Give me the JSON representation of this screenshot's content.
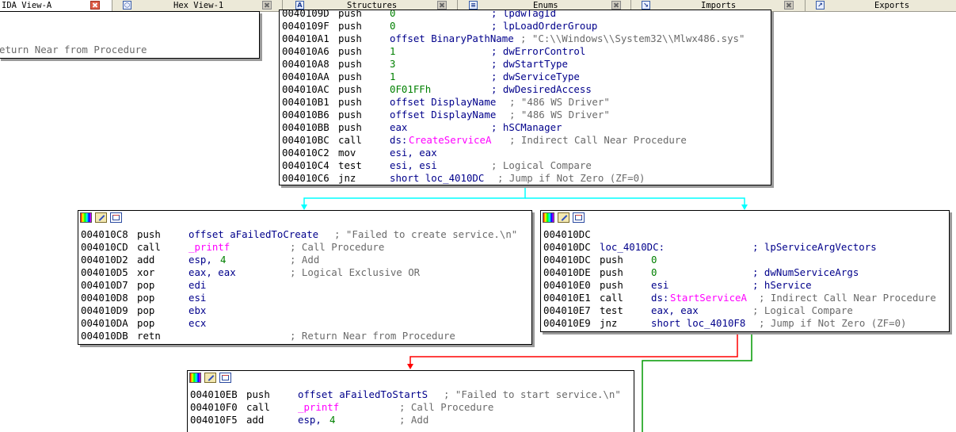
{
  "tabs": [
    {
      "label": "IDA View-A",
      "icon": "ida-view-icon",
      "active": true
    },
    {
      "label": "Hex View-1",
      "icon": "hex-view-icon",
      "active": false
    },
    {
      "label": "Structures",
      "icon": "structures-icon",
      "active": false
    },
    {
      "label": "Enums",
      "icon": "enums-icon",
      "active": false
    },
    {
      "label": "Imports",
      "icon": "imports-icon",
      "active": false
    },
    {
      "label": "Exports",
      "icon": "exports-icon",
      "active": false
    }
  ],
  "colors": {
    "edge_unconditional": "#00ffff",
    "edge_false": "#ff0000",
    "edge_true": "#009900",
    "edge_down": "#0000ff",
    "operand": "#00008b",
    "number": "#008000",
    "api": "#ff00ff",
    "comment": "#6a6a6a"
  },
  "block_top_left": {
    "line": {
      "comment": "eturn Near from Procedure"
    }
  },
  "block_main": {
    "partial_top": {
      "addr": "0040109D",
      "mnem": "push",
      "op": "0",
      "comment": "; lpdwTagId"
    },
    "lines": [
      {
        "addr": "0040109F",
        "mnem": "push",
        "op": "0",
        "comment": "; lpLoadOrderGroup"
      },
      {
        "addr": "004010A1",
        "mnem": "push",
        "op": "offset BinaryPathName",
        "comment": "; \"C:\\\\Windows\\\\System32\\\\Mlwx486.sys\""
      },
      {
        "addr": "004010A6",
        "mnem": "push",
        "op": "1",
        "comment": "; dwErrorControl"
      },
      {
        "addr": "004010A8",
        "mnem": "push",
        "op": "3",
        "comment": "; dwStartType"
      },
      {
        "addr": "004010AA",
        "mnem": "push",
        "op": "1",
        "comment": "; dwServiceType"
      },
      {
        "addr": "004010AC",
        "mnem": "push",
        "op": "0F01FFh",
        "comment": "; dwDesiredAccess"
      },
      {
        "addr": "004010B1",
        "mnem": "push",
        "op": "offset DisplayName",
        "comment": "; \"486 WS Driver\""
      },
      {
        "addr": "004010B6",
        "mnem": "push",
        "op": "offset DisplayName",
        "comment": "; \"486 WS Driver\""
      },
      {
        "addr": "004010BB",
        "mnem": "push",
        "op": "eax",
        "comment": "; hSCManager"
      },
      {
        "addr": "004010BC",
        "mnem": "call",
        "op_prefix": "ds:",
        "op_api": "CreateServiceA",
        "comment": "; Indirect Call Near Procedure"
      },
      {
        "addr": "004010C2",
        "mnem": "mov",
        "op": "esi, eax",
        "comment": ""
      },
      {
        "addr": "004010C4",
        "mnem": "test",
        "op": "esi, esi",
        "comment": "; Logical Compare"
      },
      {
        "addr": "004010C6",
        "mnem": "jnz",
        "op": "short loc_4010DC",
        "comment": "; Jump if Not Zero (ZF=0)"
      }
    ]
  },
  "block_fail_create": {
    "lines": [
      {
        "addr": "004010C8",
        "mnem": "push",
        "op": "offset aFailedToCreate",
        "comment": "; \"Failed to create service.\\n\""
      },
      {
        "addr": "004010CD",
        "mnem": "call",
        "op_imp": "_printf",
        "comment": "; Call Procedure"
      },
      {
        "addr": "004010D2",
        "mnem": "add",
        "op": "esp,",
        "op_num": "4",
        "comment": "; Add"
      },
      {
        "addr": "004010D5",
        "mnem": "xor",
        "op": "eax, eax",
        "comment": "; Logical Exclusive OR"
      },
      {
        "addr": "004010D7",
        "mnem": "pop",
        "op": "edi",
        "comment": ""
      },
      {
        "addr": "004010D8",
        "mnem": "pop",
        "op": "esi",
        "comment": ""
      },
      {
        "addr": "004010D9",
        "mnem": "pop",
        "op": "ebx",
        "comment": ""
      },
      {
        "addr": "004010DA",
        "mnem": "pop",
        "op": "ecx",
        "comment": ""
      },
      {
        "addr": "004010DB",
        "mnem": "retn",
        "op": "",
        "comment": "; Return Near from Procedure"
      }
    ]
  },
  "block_loc_4010DC": {
    "lines": [
      {
        "addr": "004010DC",
        "mnem": "",
        "op": "",
        "comment": ""
      },
      {
        "addr": "004010DC",
        "label": "loc_4010DC:",
        "comment": "; lpServiceArgVectors"
      },
      {
        "addr": "004010DC",
        "mnem": "push",
        "op_num": "0",
        "comment": ""
      },
      {
        "addr": "004010DE",
        "mnem": "push",
        "op_num": "0",
        "comment": "; dwNumServiceArgs"
      },
      {
        "addr": "004010E0",
        "mnem": "push",
        "op": "esi",
        "comment": "; hService"
      },
      {
        "addr": "004010E1",
        "mnem": "call",
        "op_prefix": "ds:",
        "op_api": "StartServiceA",
        "comment": "; Indirect Call Near Procedure"
      },
      {
        "addr": "004010E7",
        "mnem": "test",
        "op": "eax, eax",
        "comment": "; Logical Compare"
      },
      {
        "addr": "004010E9",
        "mnem": "jnz",
        "op": "short loc_4010F8",
        "comment": "; Jump if Not Zero (ZF=0)"
      }
    ]
  },
  "block_fail_start": {
    "lines": [
      {
        "addr": "004010EB",
        "mnem": "push",
        "op": "offset aFailedToStartS",
        "comment": "; \"Failed to start service.\\n\""
      },
      {
        "addr": "004010F0",
        "mnem": "call",
        "op_imp": "_printf",
        "comment": "; Call Procedure"
      },
      {
        "addr": "004010F5",
        "mnem": "add",
        "op": "esp,",
        "op_num": "4",
        "comment": "; Add"
      }
    ]
  }
}
